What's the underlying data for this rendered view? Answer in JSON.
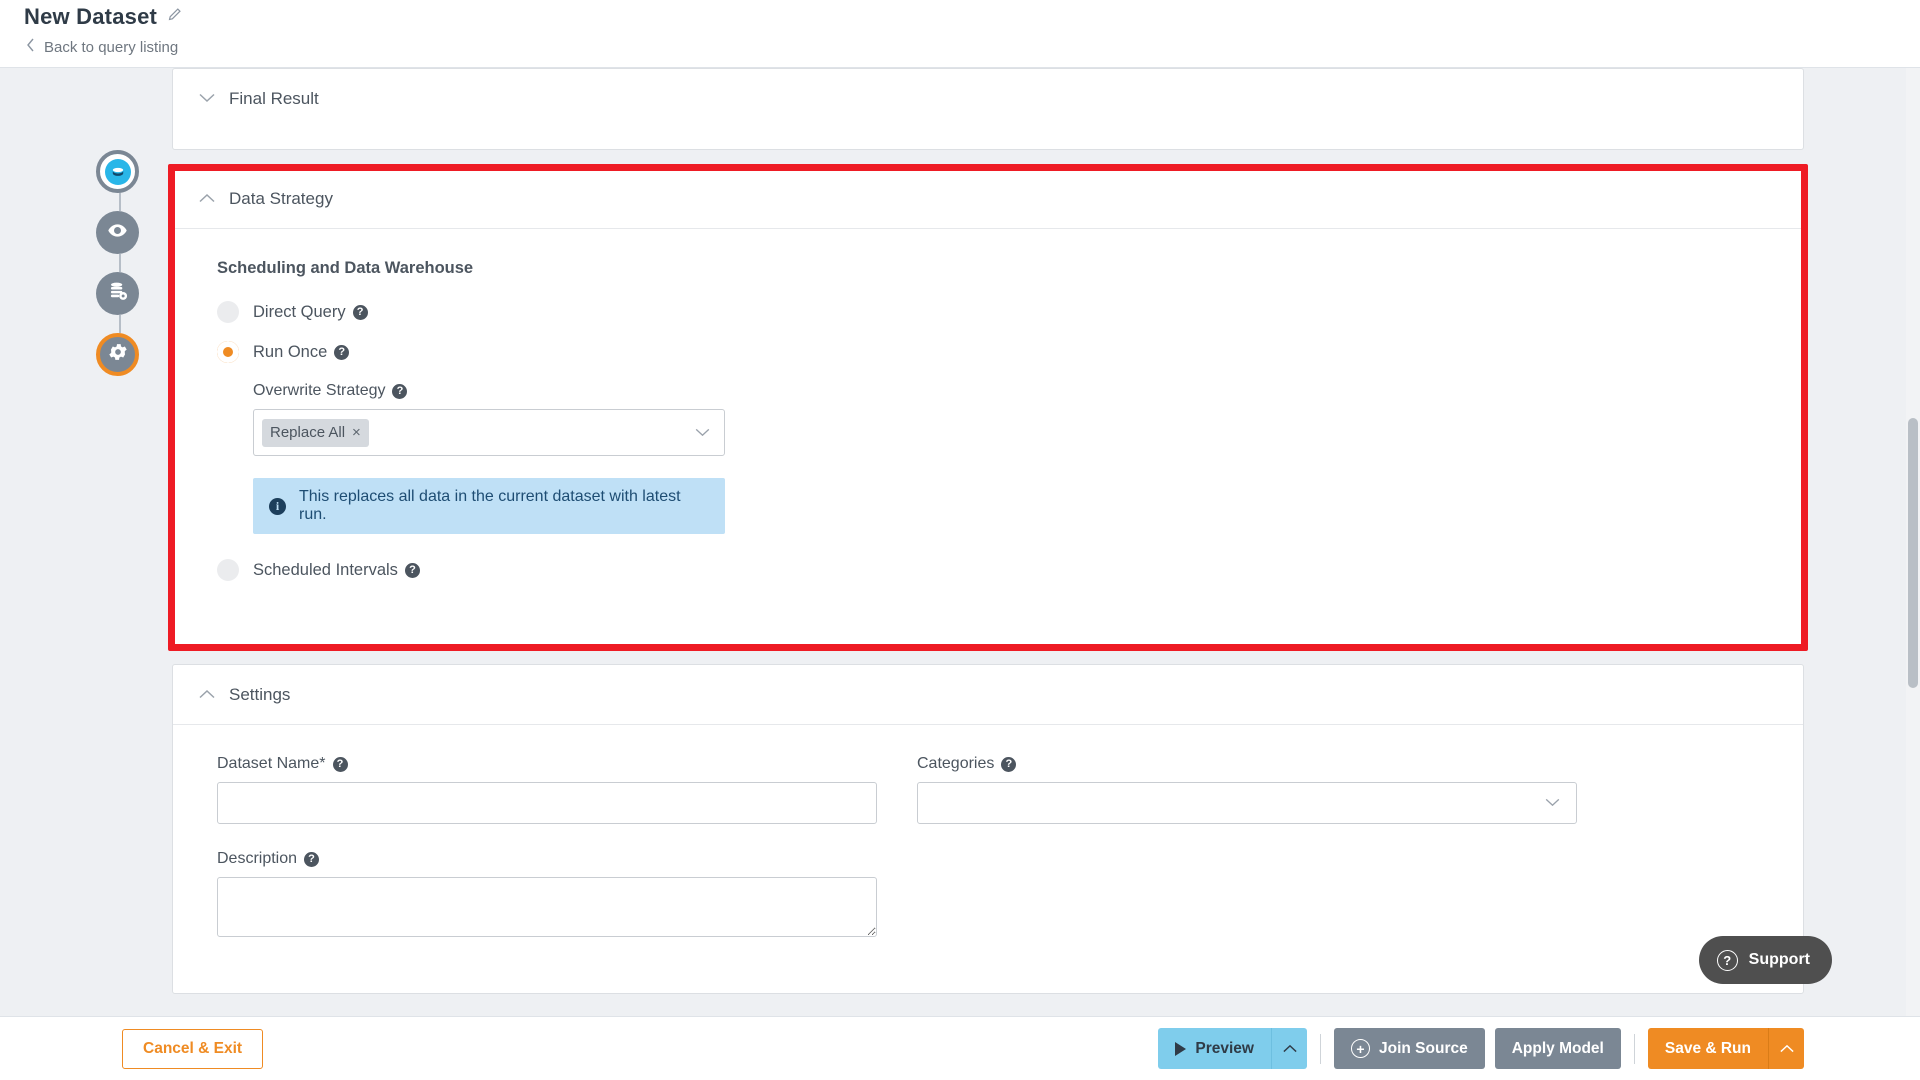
{
  "header": {
    "title": "New Dataset",
    "edit_icon": "pencil-icon",
    "back_link": "Back to query listing"
  },
  "stepper": {
    "steps": [
      {
        "icon": "database-cloud-icon",
        "state": "current-blue"
      },
      {
        "icon": "eye-icon",
        "state": "complete"
      },
      {
        "icon": "database-gear-icon",
        "state": "complete"
      },
      {
        "icon": "gear-icon",
        "state": "active-orange"
      }
    ]
  },
  "sections": {
    "final_result": {
      "title": "Final Result",
      "caret": "chevron-down-icon",
      "collapsed": true
    },
    "data_strategy": {
      "title": "Data Strategy",
      "caret": "chevron-up-icon",
      "subheading": "Scheduling and Data Warehouse",
      "options": [
        {
          "label": "Direct Query",
          "selected": false
        },
        {
          "label": "Run Once",
          "selected": true
        },
        {
          "label": "Scheduled Intervals",
          "selected": false
        }
      ],
      "overwrite_strategy": {
        "label": "Overwrite Strategy",
        "chip": "Replace All",
        "chip_remove": "×",
        "caret": "chevron-down-icon"
      },
      "info_banner": {
        "icon": "info-icon",
        "text": "This replaces all data in the current dataset with latest run."
      },
      "highlight_color": "#ee1b24"
    },
    "settings": {
      "title": "Settings",
      "caret": "chevron-up-icon",
      "fields": {
        "dataset_name_label": "Dataset Name*",
        "dataset_name_value": "",
        "categories_label": "Categories",
        "categories_value": "",
        "description_label": "Description",
        "description_value": ""
      }
    }
  },
  "footer": {
    "cancel": "Cancel & Exit",
    "preview": "Preview",
    "preview_caret": "chevron-up-icon",
    "join_source": "Join Source",
    "apply_model": "Apply Model",
    "save_run": "Save & Run",
    "save_caret": "chevron-up-icon"
  },
  "support": {
    "label": "Support",
    "icon": "question-circle-icon"
  },
  "colors": {
    "orange": "#ef8b23",
    "blue": "#7fcdec",
    "gray": "#7b8794",
    "highlight_red": "#ee1b24",
    "info_bg": "#bfe0f6"
  }
}
